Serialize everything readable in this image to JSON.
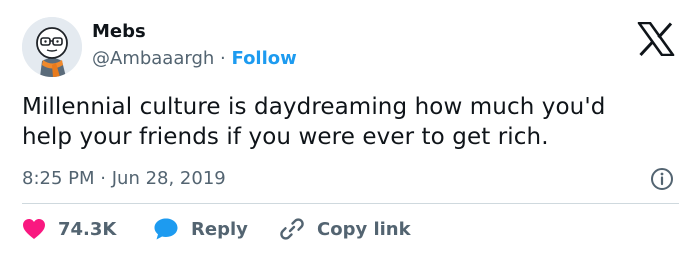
{
  "author": {
    "name": "Mebs",
    "handle": "@Ambaaargh",
    "separator": "·",
    "follow_label": "Follow"
  },
  "tweet": {
    "lines": [
      "Millennial culture is daydreaming how much you'd",
      "help your friends if you were ever to get rich."
    ],
    "time": "8:25 PM",
    "date": "Jun 28, 2019"
  },
  "actions": {
    "likes": "74.3K",
    "reply_label": "Reply",
    "copy_link_label": "Copy link"
  },
  "colors": {
    "accent": "#1d9bf0",
    "like": "#f91880",
    "text": "#0f1419",
    "muted": "#536471"
  },
  "icons": {
    "brand": "x-logo-icon",
    "info": "info-icon",
    "like": "heart-icon",
    "reply": "chat-bubble-icon",
    "copy_link": "link-icon"
  }
}
